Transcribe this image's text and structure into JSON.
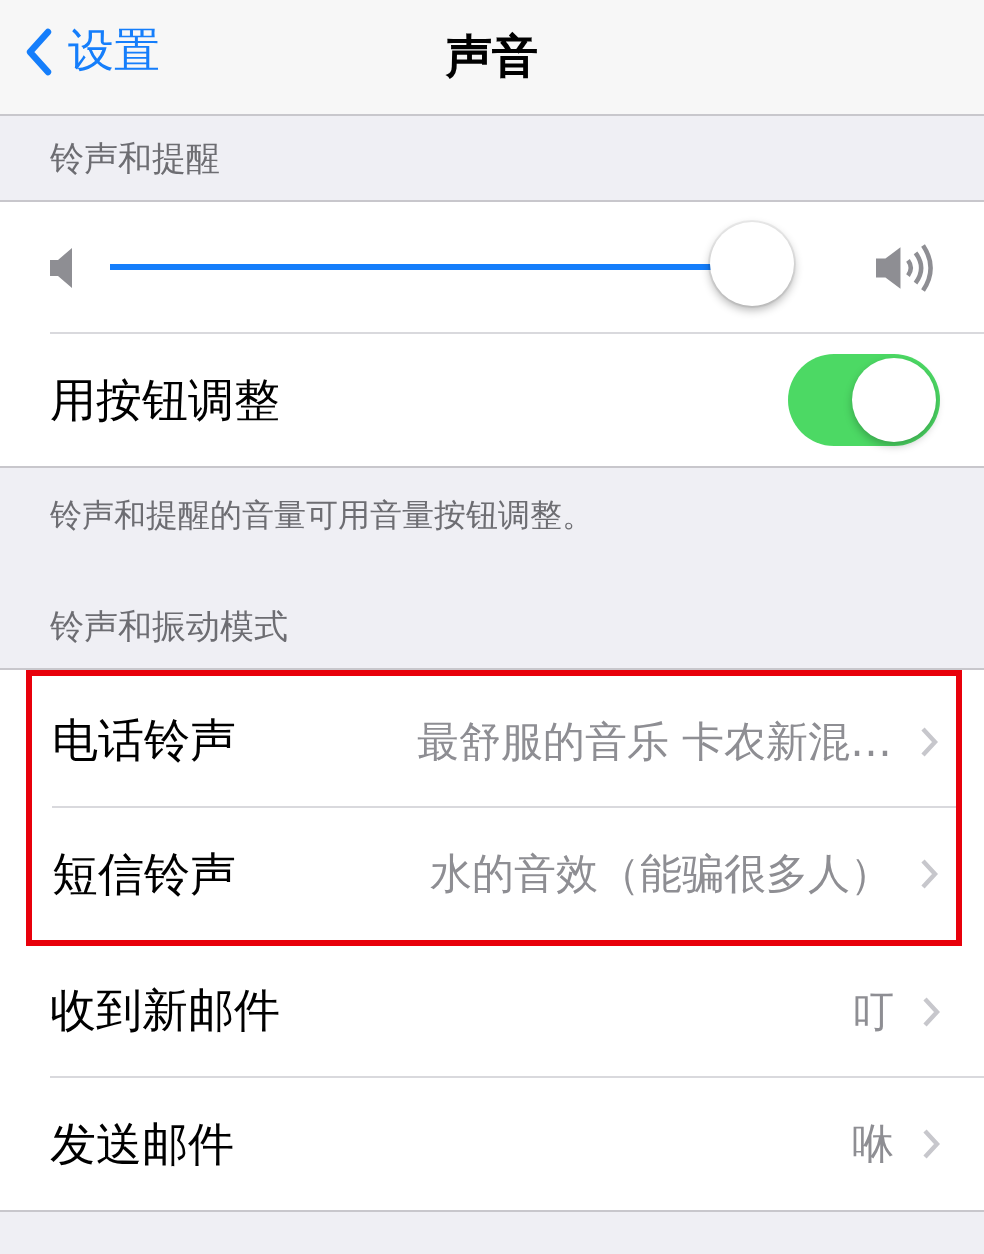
{
  "nav": {
    "back": "设置",
    "title": "声音"
  },
  "sections": [
    {
      "header": "铃声和提醒",
      "rows": [
        {
          "kind": "slider",
          "level": 0.94
        },
        {
          "kind": "toggle",
          "label": "用按钮调整",
          "on": true
        }
      ],
      "footer": "铃声和提醒的音量可用音量按钮调整。"
    },
    {
      "header": "铃声和振动模式",
      "rows": [
        {
          "kind": "link",
          "label": "电话铃声",
          "value": "最舒服的音乐 卡农新混…",
          "highlighted": true
        },
        {
          "kind": "link",
          "label": "短信铃声",
          "value": "水的音效（能骗很多人）",
          "highlighted": true
        },
        {
          "kind": "link",
          "label": "收到新邮件",
          "value": "叮",
          "highlighted": false
        },
        {
          "kind": "link",
          "label": "发送邮件",
          "value": "咻",
          "highlighted": false
        }
      ]
    }
  ]
}
